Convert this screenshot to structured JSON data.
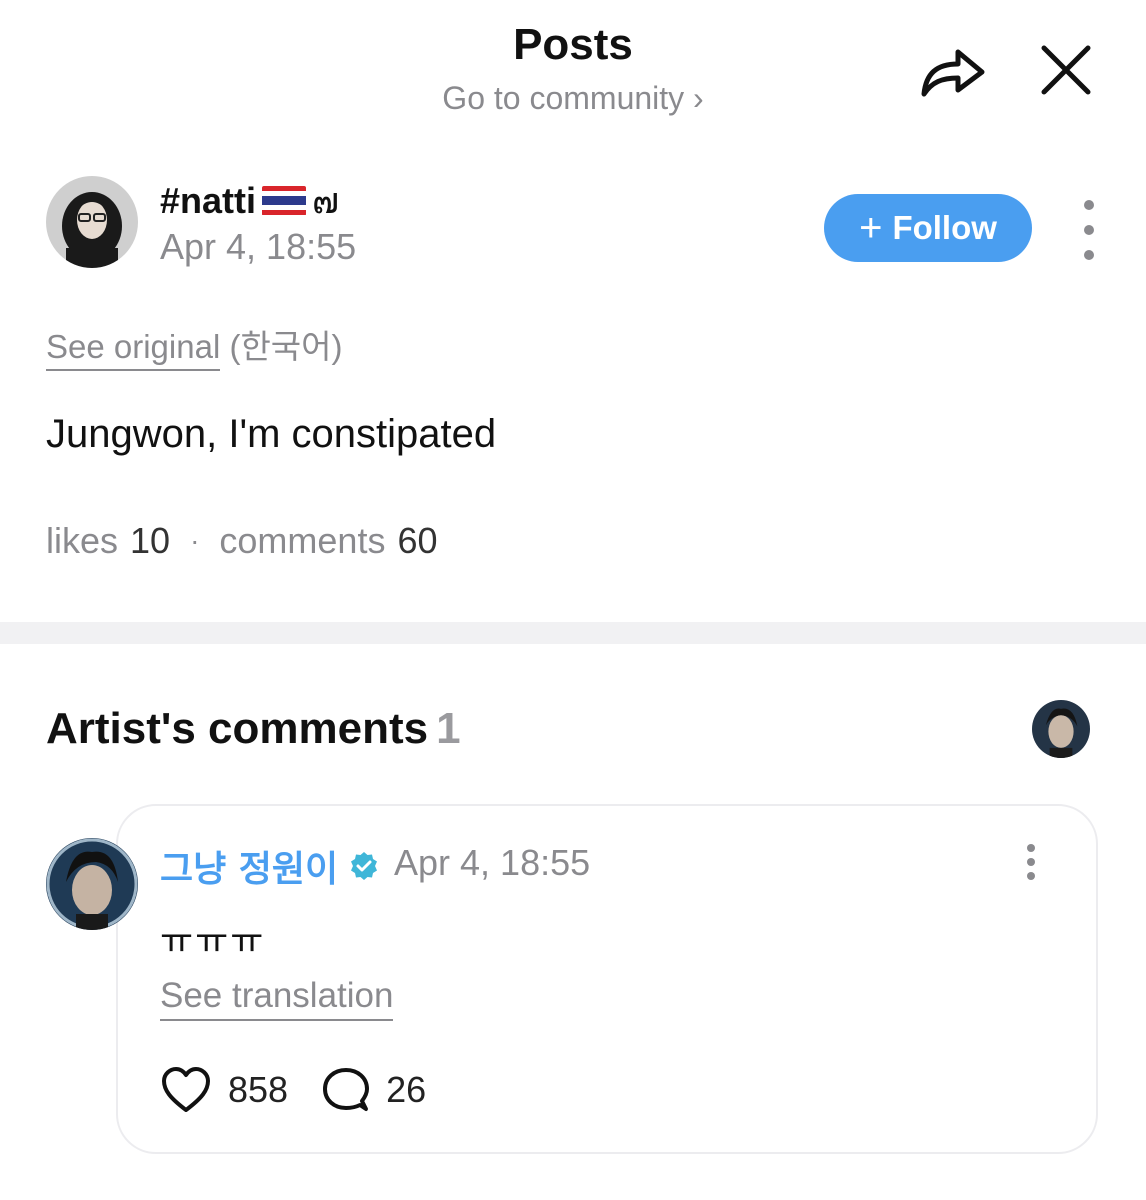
{
  "header": {
    "title": "Posts",
    "subtitle": "Go to community",
    "chevron": "›",
    "share_icon": "share-arrow-icon",
    "close_icon": "close-icon"
  },
  "post": {
    "author": {
      "name_prefix": "#natti",
      "flag_icon": "thailand-flag-icon",
      "name_suffix": "๗",
      "date": "Apr 4, 18:55"
    },
    "follow_button": {
      "plus": "+",
      "label": "Follow"
    },
    "see_original": {
      "link": "See original",
      "language": "(한국어)"
    },
    "body": "Jungwon, I'm constipated",
    "stats": {
      "likes_label": "likes",
      "likes_value": "10",
      "separator": "·",
      "comments_label": "comments",
      "comments_value": "60"
    }
  },
  "artist_comments": {
    "title": "Artist's comments",
    "count": "1",
    "comment": {
      "author": "그냥 정원이",
      "verified_icon": "verified-badge-icon",
      "date": "Apr 4, 18:55",
      "body": "ㅠㅠㅠ",
      "translate_link": "See translation",
      "likes": "858",
      "replies": "26"
    }
  },
  "colors": {
    "accent": "#4a9ef0",
    "muted_text": "#8a8a8e",
    "divider": "#f1f1f3",
    "verified": "#3fb6d8"
  }
}
